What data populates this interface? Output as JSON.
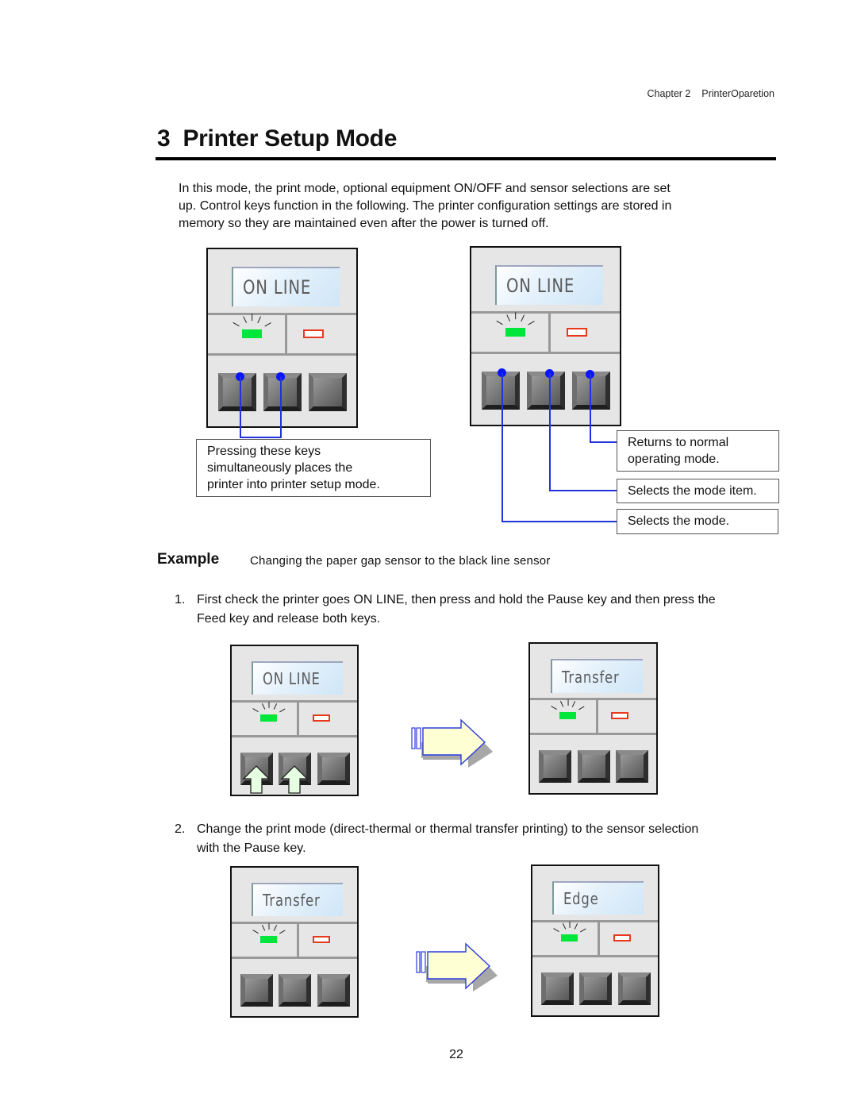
{
  "header": {
    "chapter": "Chapter 2",
    "chapter_title": "PrinterOparetion"
  },
  "section": {
    "number": "3",
    "title": "Printer Setup Mode",
    "intro_lines": [
      "In this mode, the print mode, optional equipment ON/OFF and sensor selections are set",
      "up. Control keys function in the following. The printer configuration settings are stored in",
      "memory so they are maintained even after the power is turned off."
    ]
  },
  "figures": {
    "left_panel": {
      "display": "ON LINE",
      "highlighted_keys": [
        1,
        2
      ]
    },
    "right_panel": {
      "display": "ON LINE",
      "highlighted_keys": [
        1,
        2,
        3
      ]
    },
    "left_callout": [
      "Pressing these keys",
      "simultaneously places the",
      "printer into printer setup mode."
    ],
    "right_callouts": [
      {
        "key": 3,
        "lines": [
          "Returns to normal",
          "operating mode."
        ]
      },
      {
        "key": 2,
        "lines": [
          "Selects the mode item."
        ]
      },
      {
        "key": 1,
        "lines": [
          "Selects the mode."
        ]
      }
    ]
  },
  "example": {
    "label": "Example",
    "text": "Changing the paper gap sensor to the black line sensor",
    "steps": [
      {
        "number": "1.",
        "lines": [
          "First check the printer goes ON LINE, then press and hold the Pause key and then press the",
          "Feed key and release both keys."
        ],
        "before_display": "ON LINE",
        "after_display": "Transfer",
        "pressed_keys": [
          1,
          2
        ]
      },
      {
        "number": "2.",
        "lines": [
          "Change the print mode (direct-thermal or thermal transfer printing) to the sensor selection",
          "with the Pause key."
        ],
        "before_display": "Transfer",
        "after_display": "Edge",
        "pressed_keys": []
      }
    ]
  },
  "page_number": "22",
  "colors": {
    "ready_led": "#00e63a",
    "error_led": "#e8391f",
    "callout_line": "#2233dd",
    "arrow_fill": "#ffffd4",
    "press_arrow": "#e6ffe2"
  }
}
